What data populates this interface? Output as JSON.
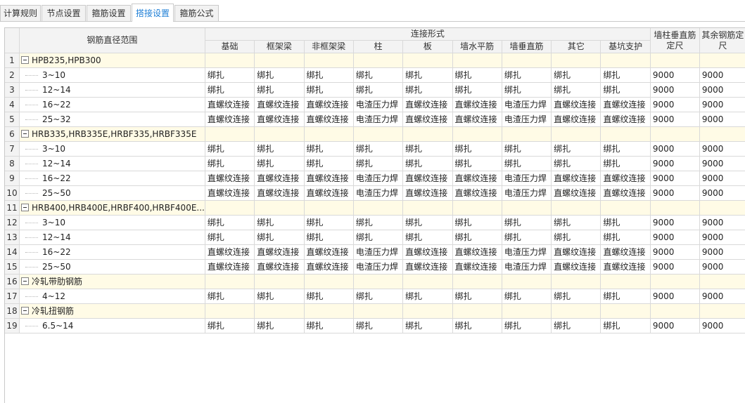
{
  "tabs": [
    {
      "label": "计算规则",
      "active": false
    },
    {
      "label": "节点设置",
      "active": false
    },
    {
      "label": "箍筋设置",
      "active": false
    },
    {
      "label": "搭接设置",
      "active": true
    },
    {
      "label": "箍筋公式",
      "active": false
    }
  ],
  "header": {
    "range": "钢筋直径范围",
    "connection_group": "连接形式",
    "columns": [
      "基础",
      "框架梁",
      "非框架梁",
      "柱",
      "板",
      "墙水平筋",
      "墙垂直筋",
      "其它",
      "基坑支护"
    ],
    "wall_vertical_length": [
      "墙柱垂直筋",
      "定尺"
    ],
    "other_length": [
      "其余钢筋定",
      "尺"
    ]
  },
  "rows": [
    {
      "no": "1",
      "type": "group",
      "label": "HPB235,HPB300",
      "cells": []
    },
    {
      "no": "2",
      "type": "item",
      "label": "3~10",
      "cells": [
        "绑扎",
        "绑扎",
        "绑扎",
        "绑扎",
        "绑扎",
        "绑扎",
        "绑扎",
        "绑扎",
        "绑扎",
        "9000",
        "9000"
      ]
    },
    {
      "no": "3",
      "type": "item",
      "label": "12~14",
      "cells": [
        "绑扎",
        "绑扎",
        "绑扎",
        "绑扎",
        "绑扎",
        "绑扎",
        "绑扎",
        "绑扎",
        "绑扎",
        "9000",
        "9000"
      ]
    },
    {
      "no": "4",
      "type": "item",
      "label": "16~22",
      "cells": [
        "直螺纹连接",
        "直螺纹连接",
        "直螺纹连接",
        "电渣压力焊",
        "直螺纹连接",
        "直螺纹连接",
        "电渣压力焊",
        "直螺纹连接",
        "直螺纹连接",
        "9000",
        "9000"
      ]
    },
    {
      "no": "5",
      "type": "item",
      "label": "25~32",
      "cells": [
        "直螺纹连接",
        "直螺纹连接",
        "直螺纹连接",
        "电渣压力焊",
        "直螺纹连接",
        "直螺纹连接",
        "电渣压力焊",
        "直螺纹连接",
        "直螺纹连接",
        "9000",
        "9000"
      ]
    },
    {
      "no": "6",
      "type": "group",
      "label": "HRB335,HRB335E,HRBF335,HRBF335E",
      "cells": []
    },
    {
      "no": "7",
      "type": "item",
      "label": "3~10",
      "cells": [
        "绑扎",
        "绑扎",
        "绑扎",
        "绑扎",
        "绑扎",
        "绑扎",
        "绑扎",
        "绑扎",
        "绑扎",
        "9000",
        "9000"
      ]
    },
    {
      "no": "8",
      "type": "item",
      "label": "12~14",
      "cells": [
        "绑扎",
        "绑扎",
        "绑扎",
        "绑扎",
        "绑扎",
        "绑扎",
        "绑扎",
        "绑扎",
        "绑扎",
        "9000",
        "9000"
      ]
    },
    {
      "no": "9",
      "type": "item",
      "label": "16~22",
      "cells": [
        "直螺纹连接",
        "直螺纹连接",
        "直螺纹连接",
        "电渣压力焊",
        "直螺纹连接",
        "直螺纹连接",
        "电渣压力焊",
        "直螺纹连接",
        "直螺纹连接",
        "9000",
        "9000"
      ]
    },
    {
      "no": "10",
      "type": "item",
      "label": "25~50",
      "cells": [
        "直螺纹连接",
        "直螺纹连接",
        "直螺纹连接",
        "电渣压力焊",
        "直螺纹连接",
        "直螺纹连接",
        "电渣压力焊",
        "直螺纹连接",
        "直螺纹连接",
        "9000",
        "9000"
      ]
    },
    {
      "no": "11",
      "type": "group",
      "label": "HRB400,HRB400E,HRBF400,HRBF400E...",
      "cells": []
    },
    {
      "no": "12",
      "type": "item",
      "label": "3~10",
      "cells": [
        "绑扎",
        "绑扎",
        "绑扎",
        "绑扎",
        "绑扎",
        "绑扎",
        "绑扎",
        "绑扎",
        "绑扎",
        "9000",
        "9000"
      ]
    },
    {
      "no": "13",
      "type": "item",
      "label": "12~14",
      "cells": [
        "绑扎",
        "绑扎",
        "绑扎",
        "绑扎",
        "绑扎",
        "绑扎",
        "绑扎",
        "绑扎",
        "绑扎",
        "9000",
        "9000"
      ]
    },
    {
      "no": "14",
      "type": "item",
      "label": "16~22",
      "cells": [
        "直螺纹连接",
        "直螺纹连接",
        "直螺纹连接",
        "电渣压力焊",
        "直螺纹连接",
        "直螺纹连接",
        "电渣压力焊",
        "直螺纹连接",
        "直螺纹连接",
        "9000",
        "9000"
      ]
    },
    {
      "no": "15",
      "type": "item",
      "label": "25~50",
      "cells": [
        "直螺纹连接",
        "直螺纹连接",
        "直螺纹连接",
        "电渣压力焊",
        "直螺纹连接",
        "直螺纹连接",
        "电渣压力焊",
        "直螺纹连接",
        "直螺纹连接",
        "9000",
        "9000"
      ]
    },
    {
      "no": "16",
      "type": "group",
      "label": "冷轧带肋钢筋",
      "cells": []
    },
    {
      "no": "17",
      "type": "item",
      "label": "4~12",
      "cells": [
        "绑扎",
        "绑扎",
        "绑扎",
        "绑扎",
        "绑扎",
        "绑扎",
        "绑扎",
        "绑扎",
        "绑扎",
        "9000",
        "9000"
      ]
    },
    {
      "no": "18",
      "type": "group",
      "label": "冷轧扭钢筋",
      "cells": []
    },
    {
      "no": "19",
      "type": "item",
      "label": "6.5~14",
      "cells": [
        "绑扎",
        "绑扎",
        "绑扎",
        "绑扎",
        "绑扎",
        "绑扎",
        "绑扎",
        "绑扎",
        "绑扎",
        "9000",
        "9000"
      ]
    }
  ]
}
